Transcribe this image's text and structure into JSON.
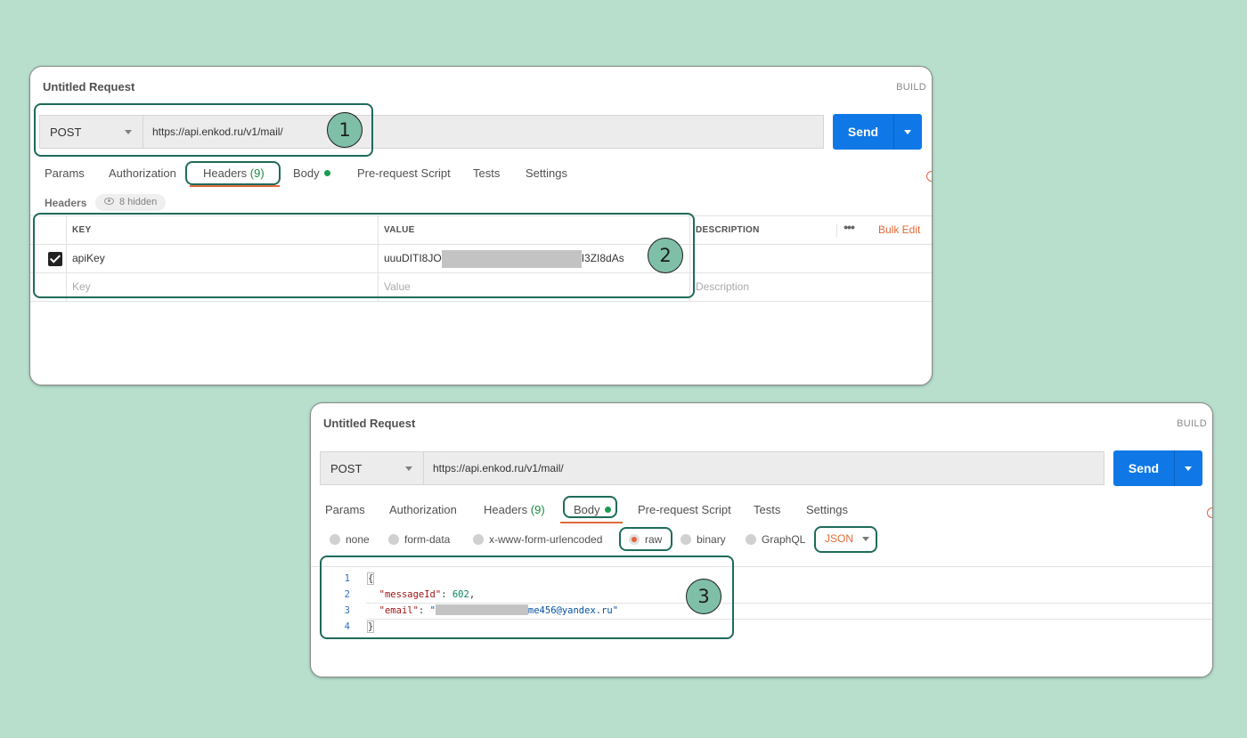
{
  "panel1": {
    "title": "Untitled Request",
    "build": "BUILD",
    "method": "POST",
    "url": "https://api.enkod.ru/v1/mail/",
    "send": "Send",
    "tabs": {
      "params": "Params",
      "authorization": "Authorization",
      "headers": "Headers",
      "headers_count": "(9)",
      "body": "Body",
      "prerequest": "Pre-request Script",
      "tests": "Tests",
      "settings": "Settings"
    },
    "headers_label": "Headers",
    "hidden_pill": "8 hidden",
    "table": {
      "col_key": "KEY",
      "col_value": "VALUE",
      "col_description": "DESCRIPTION",
      "more": "•••",
      "bulk_edit": "Bulk Edit",
      "row_key": "apiKey",
      "row_value_prefix": "uuuDITI8JO",
      "row_value_suffix": "I3ZI8dAs",
      "placeholder_key": "Key",
      "placeholder_value": "Value",
      "placeholder_description": "Description"
    }
  },
  "panel2": {
    "title": "Untitled Request",
    "build": "BUILD",
    "method": "POST",
    "url": "https://api.enkod.ru/v1/mail/",
    "send": "Send",
    "tabs": {
      "params": "Params",
      "authorization": "Authorization",
      "headers": "Headers",
      "headers_count": "(9)",
      "body": "Body",
      "prerequest": "Pre-request Script",
      "tests": "Tests",
      "settings": "Settings"
    },
    "body_types": {
      "none": "none",
      "form_data": "form-data",
      "urlencoded": "x-www-form-urlencoded",
      "raw": "raw",
      "binary": "binary",
      "graphql": "GraphQL",
      "format": "JSON"
    },
    "code": {
      "ln1": "1",
      "ln2": "2",
      "ln3": "3",
      "ln4": "4",
      "open": "{",
      "k1": "\"messageId\"",
      "colon1": ": ",
      "v1": "602",
      "comma1": ",",
      "k2": "\"email\"",
      "colon2": ": ",
      "v2_prefix": "\"",
      "v2_suffix": "me456@yandex.ru\"",
      "close": "}"
    }
  },
  "callouts": {
    "one": "1",
    "two": "2",
    "three": "3"
  },
  "colors": {
    "background": "#b7dfcc",
    "accent": "#0f78e6",
    "highlight_border": "#1e6b5a",
    "tab_underline": "#e06a3a",
    "badge": "#7fbfa8"
  }
}
